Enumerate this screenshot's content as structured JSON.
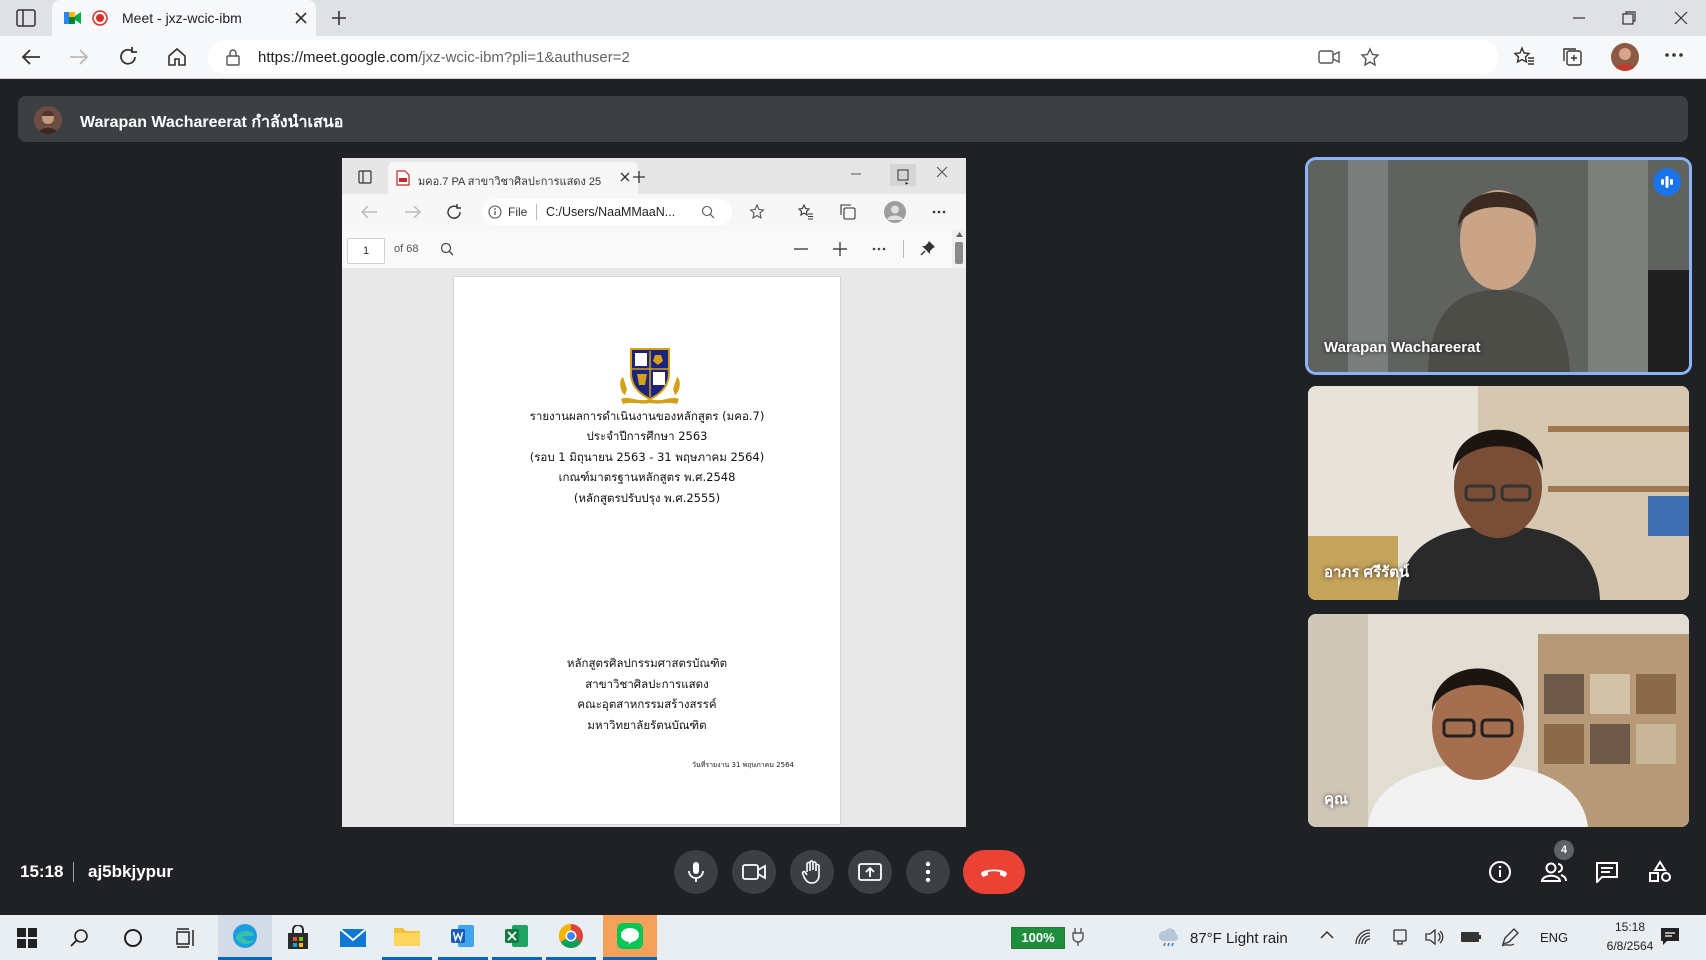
{
  "browser": {
    "tab_title": "Meet - jxz-wcic-ibm",
    "url_host": "https://meet.google.com",
    "url_path": "/jxz-wcic-ibm?pli=1&authuser=2"
  },
  "meet": {
    "presenter_text": "Warapan Wachareerat กำลังนำเสนอ",
    "time": "15:18",
    "meeting_code": "aj5bkjypur",
    "participants_count": "4",
    "end_call_color": "#ea4335",
    "tiles": [
      {
        "name": "Warapan Wachareerat",
        "active_speaker": true
      },
      {
        "name": "อาภร ศรีรัตน์"
      },
      {
        "name": "คุณ"
      }
    ]
  },
  "shared_window": {
    "tab_title": "มคอ.7 PA สาขาวิชาศิลปะการแสดง 25",
    "file_label": "File",
    "path": "C:/Users/NaaMMaaN...",
    "page_current": "1",
    "page_total": "of 68",
    "doc": {
      "title_lines": [
        "รายงานผลการดำเนินงานของหลักสูตร (มคอ.7)",
        "ประจำปีการศึกษา 2563",
        "(รอบ 1 มิถุนายน 2563 - 31 พฤษภาคม 2564)",
        "เกณฑ์มาตรฐานหลักสูตร พ.ศ.2548",
        "(หลักสูตรปรับปรุง พ.ศ.2555)"
      ],
      "program_lines": [
        "หลักสูตรศิลปกรรมศาสตรบัณฑิต",
        "สาขาวิชาศิลปะการแสดง",
        "คณะอุตสาหกรรมสร้างสรรค์",
        "มหาวิทยาลัยรัตนบัณฑิต"
      ],
      "report_date": "วันที่รายงาน 31 พฤษภาคม 2564"
    }
  },
  "taskbar": {
    "battery": "100%",
    "weather": "87°F  Light rain",
    "lang": "ENG",
    "time": "15:18",
    "date": "6/8/2564"
  }
}
